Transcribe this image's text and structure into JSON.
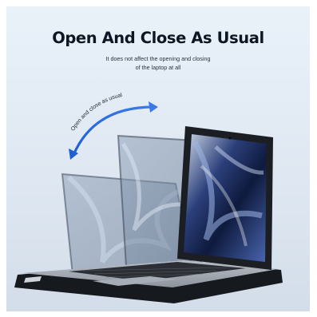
{
  "headline": "Open And Close As Usual",
  "subtitle_lines": [
    "It does not affect the opening and closing",
    "of the laptop at all"
  ],
  "arc_label": "Open and close as usual",
  "colors": {
    "background": "#e3ecf5",
    "headline": "#0d1724",
    "arrow": "#2a64c8",
    "case": "#1b1e22"
  }
}
